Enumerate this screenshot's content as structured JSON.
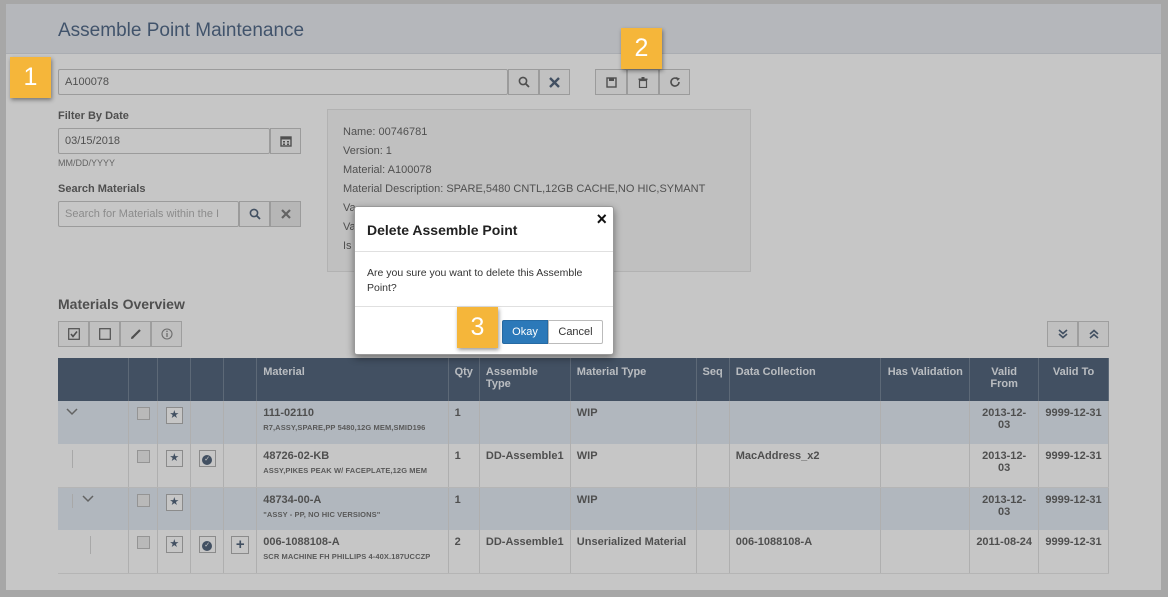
{
  "header": {
    "title": "Assemble Point Maintenance"
  },
  "search": {
    "value": "A100078"
  },
  "filter": {
    "label": "Filter By Date",
    "date_value": "03/15/2018",
    "date_format": "MM/DD/YYYY"
  },
  "search_materials": {
    "label": "Search Materials",
    "placeholder": "Search for Materials within the I"
  },
  "info": {
    "name": "Name:  00746781",
    "version": "Version:  1",
    "material": "Material:  A100078",
    "description": "Material Description:  SPARE,5480 CNTL,12GB CACHE,NO HIC,SYMANT",
    "valid_from_partial": "Va",
    "valid_to_partial": "Va",
    "is_partial": "Is"
  },
  "materials_overview": {
    "title": "Materials Overview"
  },
  "table": {
    "headers": {
      "material": "Material",
      "qty": "Qty",
      "assemble_type": "Assemble Type",
      "material_type": "Material Type",
      "seq": "Seq",
      "data_collection": "Data Collection",
      "has_validation": "Has Validation",
      "valid_from": "Valid From",
      "valid_to": "Valid To"
    },
    "rows": [
      {
        "material": "111-02110",
        "desc": "R7,ASSY,SPARE,PP 5480,12G MEM,SMID196",
        "qty": "1",
        "assemble_type": "",
        "material_type": "WIP",
        "seq": "",
        "data_collection": "",
        "has_validation": "",
        "valid_from": "2013-12-03",
        "valid_to": "9999-12-31"
      },
      {
        "material": "48726-02-KB",
        "desc": "ASSY,PIKES PEAK W/ FACEPLATE,12G MEM",
        "qty": "1",
        "assemble_type": "DD-Assemble1",
        "material_type": "WIP",
        "seq": "",
        "data_collection": "MacAddress_x2",
        "has_validation": "",
        "valid_from": "2013-12-03",
        "valid_to": "9999-12-31"
      },
      {
        "material": "48734-00-A",
        "desc": "\"ASSY - PP, NO HIC VERSIONS\"",
        "qty": "1",
        "assemble_type": "",
        "material_type": "WIP",
        "seq": "",
        "data_collection": "",
        "has_validation": "",
        "valid_from": "2013-12-03",
        "valid_to": "9999-12-31"
      },
      {
        "material": "006-1088108-A",
        "desc": "SCR MACHINE FH PHILLIPS 4-40X.187UCCZP",
        "qty": "2",
        "assemble_type": "DD-Assemble1",
        "material_type": "Unserialized Material",
        "seq": "",
        "data_collection": "006-1088108-A",
        "has_validation": "",
        "valid_from": "2011-08-24",
        "valid_to": "9999-12-31"
      }
    ]
  },
  "modal": {
    "title": "Delete Assemble Point",
    "message": "Are you sure you want to delete this Assemble Point?",
    "okay_label": "Okay",
    "cancel_label": "Cancel"
  },
  "callouts": {
    "one": "1",
    "two": "2",
    "three": "3"
  },
  "icons": {
    "search": "search-icon",
    "clear": "close-icon",
    "save": "save-icon",
    "delete": "trash-icon",
    "refresh": "refresh-icon",
    "calendar": "calendar-icon"
  },
  "colors": {
    "header_bg": "#1c3553",
    "accent": "#2c79b9",
    "callout": "#f5b63a",
    "alt_row": "#dbe6f1"
  }
}
